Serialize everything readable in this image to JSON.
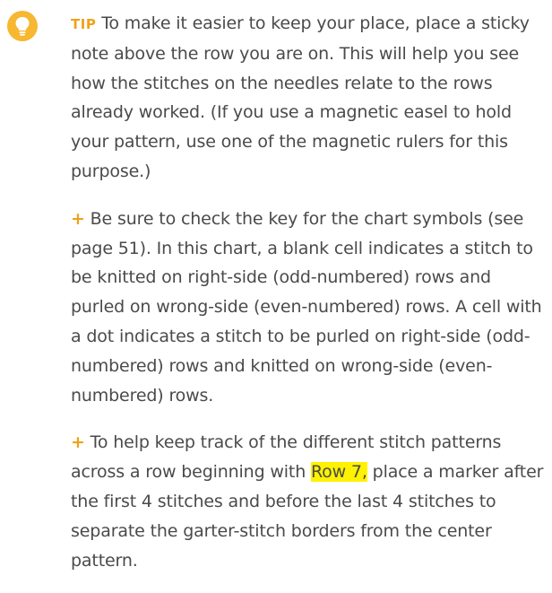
{
  "tip": {
    "label": "TIP",
    "text": " To make it easier to keep your place, place a sticky note above the row you are on. This will help you see how the stitches on the needles relate to the rows already worked. (If you use a magnetic easel to hold your pattern, use one of the magnetic rulers for this purpose.)"
  },
  "bullets": {
    "marker": "+",
    "b1": {
      "text": " Be sure to check the key for the chart symbols (see page 51). In this chart, a blank cell indicates a stitch to be knitted on right-side (odd-numbered) rows and purled on wrong-side (even-numbered) rows. A cell with a dot indicates a stitch to be purled on right-side (odd-numbered) rows and knitted on wrong-side (even-numbered) rows."
    },
    "b2": {
      "text_before": " To help keep track of the different stitch patterns across a row beginning with ",
      "highlight": "Row 7,",
      "text_after": " place a marker after the first 4 stitches and before the last 4 stitches to separate the garter-stitch borders from the center pattern."
    }
  },
  "colors": {
    "accent": "#f0a21b",
    "icon_bg": "#f7b731",
    "highlight": "#fff200",
    "text": "#4a4a4a"
  },
  "icons": {
    "tip": "lightbulb-icon"
  }
}
